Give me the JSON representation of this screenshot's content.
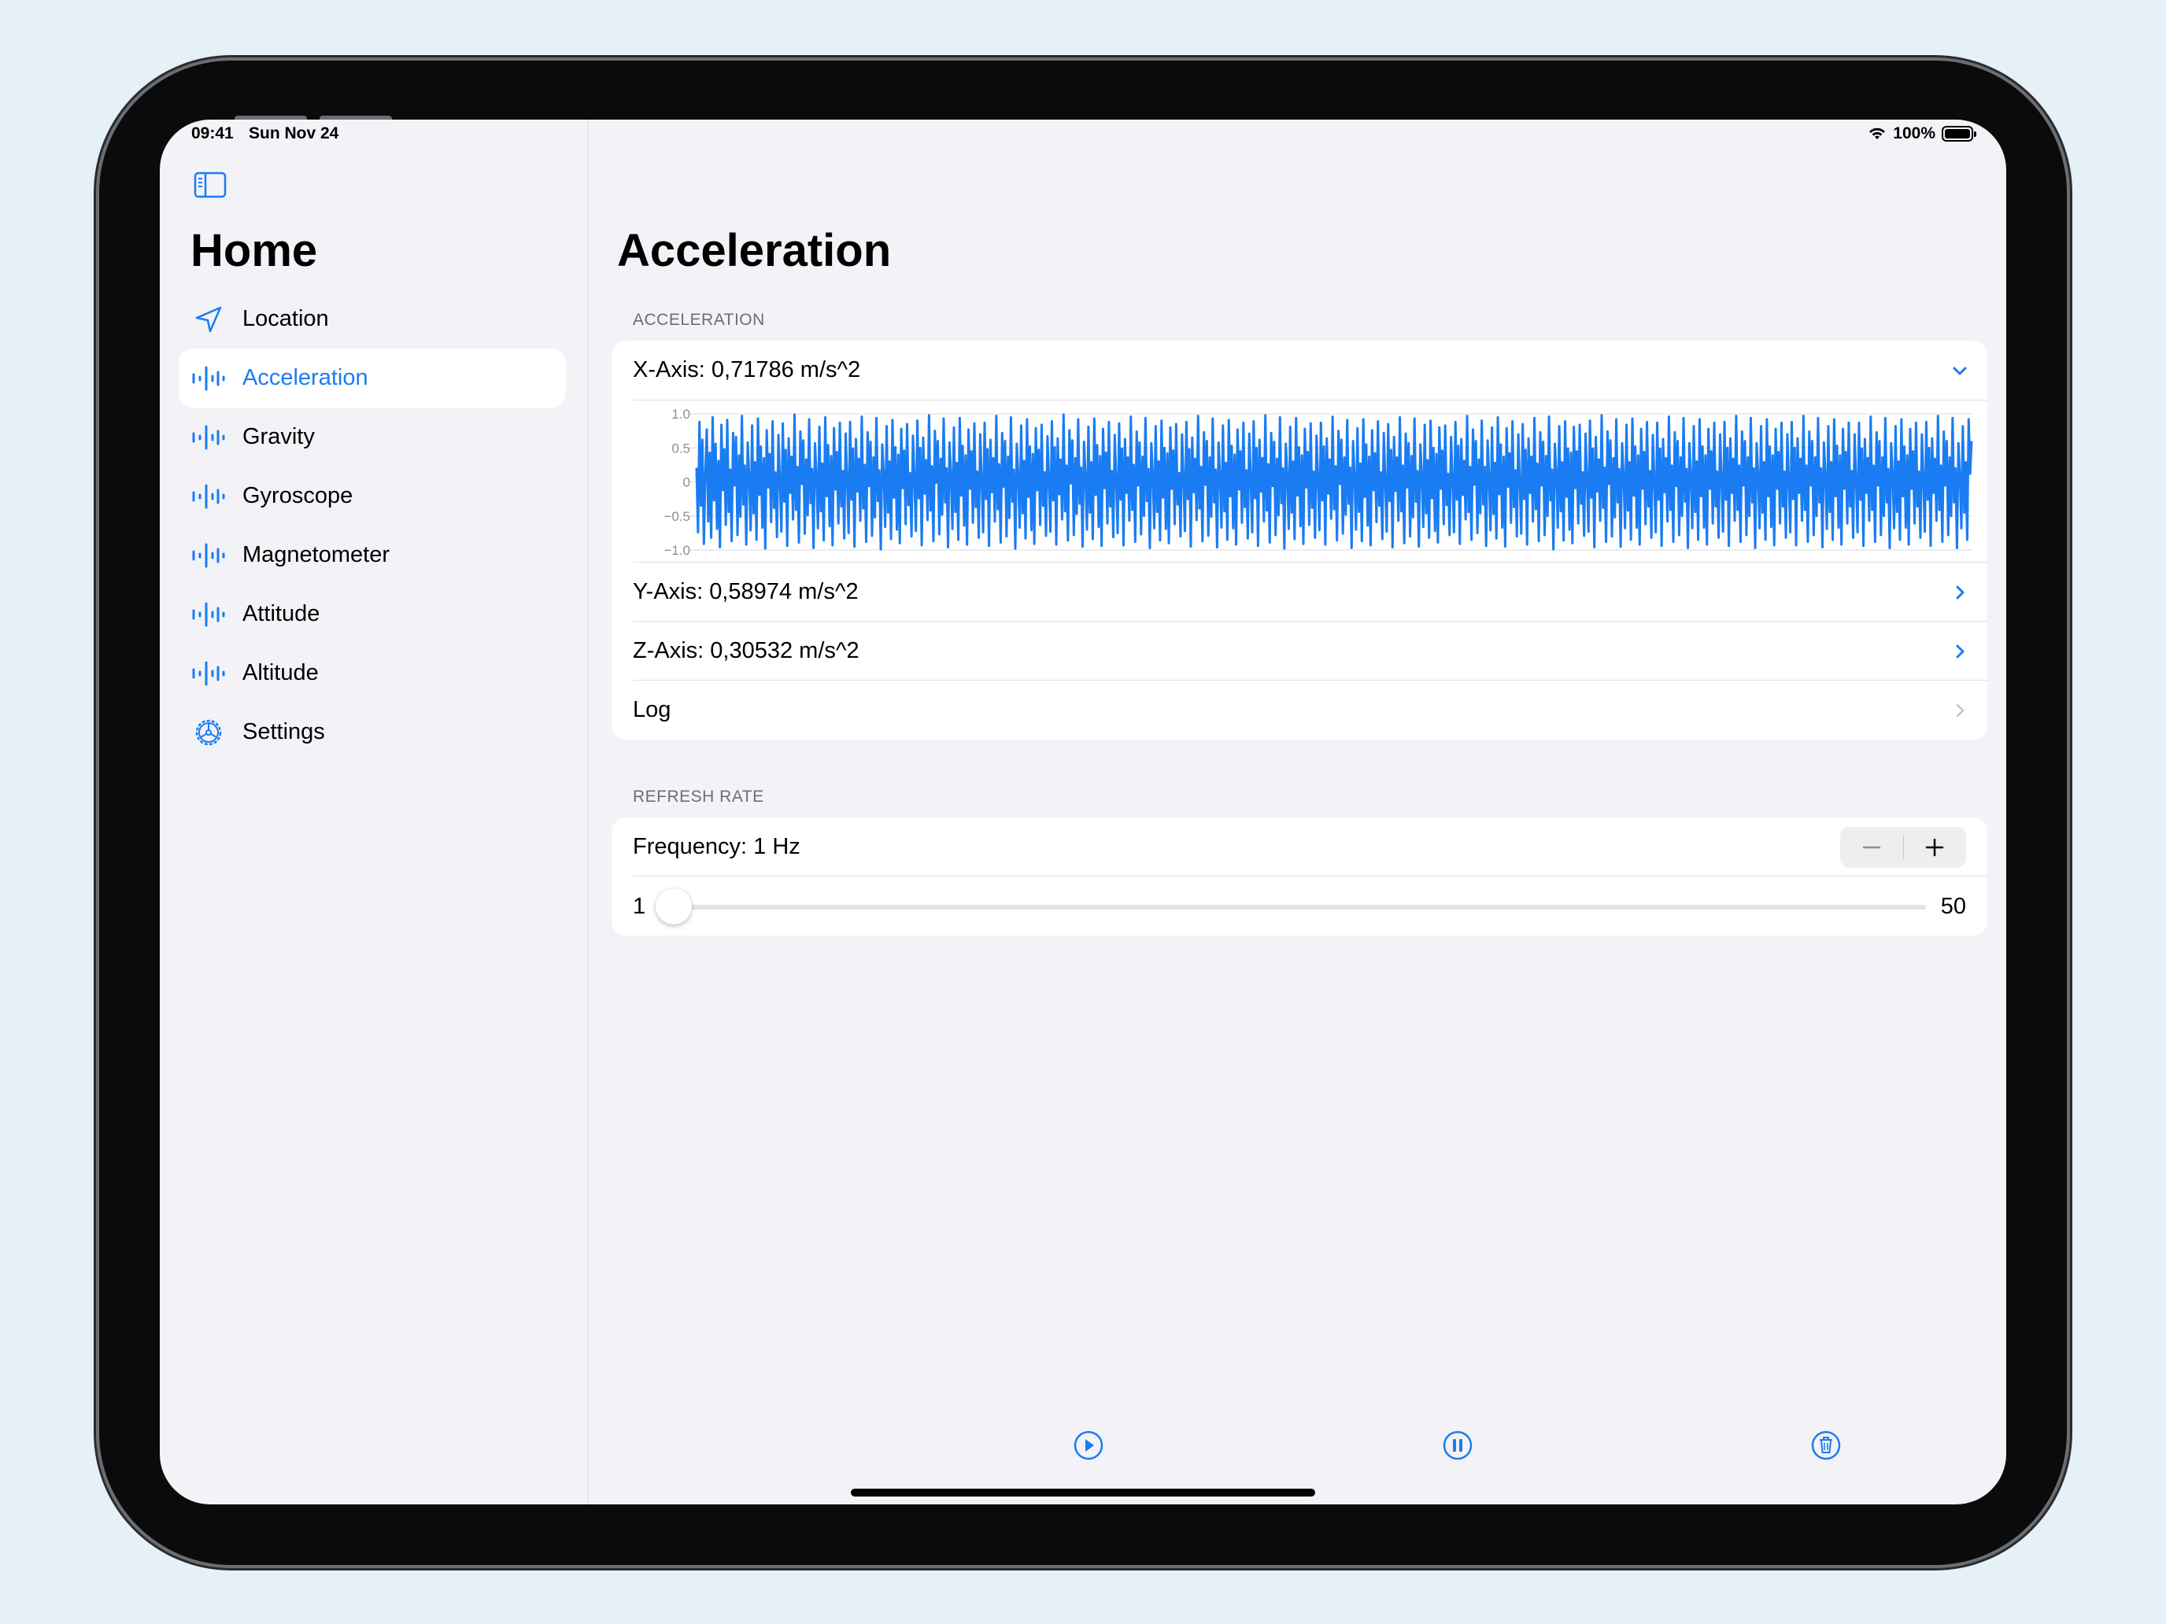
{
  "status_bar": {
    "time": "09:41",
    "date": "Sun Nov 24",
    "battery": "100%"
  },
  "sidebar": {
    "title": "Home",
    "items": [
      {
        "label": "Location",
        "icon": "location-arrow-icon",
        "selected": false
      },
      {
        "label": "Acceleration",
        "icon": "waveform-icon",
        "selected": true
      },
      {
        "label": "Gravity",
        "icon": "waveform-icon",
        "selected": false
      },
      {
        "label": "Gyroscope",
        "icon": "waveform-icon",
        "selected": false
      },
      {
        "label": "Magnetometer",
        "icon": "waveform-icon",
        "selected": false
      },
      {
        "label": "Attitude",
        "icon": "waveform-icon",
        "selected": false
      },
      {
        "label": "Altitude",
        "icon": "waveform-icon",
        "selected": false
      },
      {
        "label": "Settings",
        "icon": "gear-icon",
        "selected": false
      }
    ]
  },
  "main": {
    "title": "Acceleration",
    "acceleration_section": {
      "header": "ACCELERATION",
      "x_axis": "X-Axis: 0,71786 m/s^2",
      "y_axis": "Y-Axis: 0,58974 m/s^2",
      "z_axis": "Z-Axis: 0,30532 m/s^2",
      "log": "Log"
    },
    "refresh_section": {
      "header": "REFRESH RATE",
      "frequency": "Frequency: 1 Hz",
      "slider_min": "1",
      "slider_max": "50",
      "slider_value": 1
    }
  },
  "colors": {
    "accent": "#1a7cf2",
    "background": "#f2f2f7"
  },
  "chart_data": {
    "type": "line",
    "y_ticks": [
      "1.0",
      "0.5",
      "0",
      "−0.5",
      "−1.0"
    ],
    "ylim": [
      -1.0,
      1.0
    ],
    "series": [
      {
        "values": [
          0.21,
          -0.74,
          0.88,
          -0.35,
          0.62,
          -0.91,
          0.12,
          0.77,
          -0.58,
          0.43,
          -0.82,
          0.95,
          -0.27,
          0.56,
          -0.69,
          0.31,
          -0.96,
          0.84,
          -0.12,
          0.48,
          -0.63,
          0.91,
          -0.44,
          0.18,
          -0.87,
          0.72,
          -0.05,
          0.66,
          -0.78,
          0.39,
          -0.51,
          0.97,
          -0.33,
          0.24,
          -0.92,
          0.58,
          0.07,
          -0.71,
          0.83,
          -0.46,
          0.29,
          -0.85,
          0.93,
          -0.19,
          0.52,
          -0.67,
          0.35,
          -0.98,
          0.76,
          -0.08,
          0.41,
          -0.59,
          0.89,
          -0.38,
          0.14,
          -0.81,
          0.69,
          0.02,
          -0.73,
          0.86,
          -0.29,
          0.47,
          -0.94,
          0.64,
          -0.16,
          0.37,
          -0.55,
          0.99,
          -0.41,
          0.22,
          -0.89,
          0.74,
          -0.03,
          0.61,
          -0.76,
          0.33,
          -0.49,
          0.92,
          -0.31,
          0.19,
          -0.97,
          0.57,
          0.09,
          -0.68,
          0.81,
          -0.43,
          0.27,
          -0.86,
          0.95,
          -0.21,
          0.54,
          -0.65,
          0.38,
          -0.93,
          0.79,
          -0.11,
          0.44,
          -0.61,
          0.87,
          -0.36,
          0.16,
          -0.83,
          0.71,
          0.04,
          -0.75,
          0.88,
          -0.26,
          0.49,
          -0.95,
          0.63,
          -0.14,
          0.34,
          -0.57,
          0.96,
          -0.39,
          0.25,
          -0.88,
          0.73,
          -0.06,
          0.59,
          -0.79,
          0.36,
          -0.52,
          0.94,
          -0.28,
          0.17,
          -0.99,
          0.55,
          0.11,
          -0.66,
          0.82,
          -0.45,
          0.3,
          -0.84,
          0.91,
          -0.23,
          0.51,
          -0.7,
          0.4,
          -0.9,
          0.78,
          -0.09,
          0.46,
          -0.62,
          0.85,
          -0.34,
          0.13,
          -0.8,
          0.68,
          0.06,
          -0.72,
          0.9,
          -0.24,
          0.5,
          -0.93,
          0.65,
          -0.17,
          0.32,
          -0.56,
          0.98,
          -0.42,
          0.23,
          -0.87,
          0.75,
          -0.01,
          0.6,
          -0.77,
          0.34,
          -0.48,
          0.93,
          -0.3,
          0.2,
          -0.96,
          0.58,
          0.08,
          -0.69,
          0.8,
          -0.44,
          0.28,
          -0.85,
          0.94,
          -0.2,
          0.53,
          -0.64,
          0.39,
          -0.92,
          0.77,
          -0.1,
          0.45,
          -0.6,
          0.86,
          -0.37,
          0.15,
          -0.82,
          0.7,
          0.03,
          -0.74,
          0.87,
          -0.25,
          0.48,
          -0.94,
          0.62,
          -0.15,
          0.35,
          -0.58,
          0.97,
          -0.4,
          0.26,
          -0.89,
          0.72,
          -0.07,
          0.6,
          -0.8,
          0.37,
          -0.53,
          0.95,
          -0.29,
          0.18,
          -0.98,
          0.56,
          0.1,
          -0.67,
          0.83,
          -0.46,
          0.31,
          -0.83,
          0.92,
          -0.22,
          0.52,
          -0.71,
          0.41,
          -0.91,
          0.79,
          -0.12,
          0.47,
          -0.63,
          0.84,
          -0.35,
          0.14,
          -0.79,
          0.67,
          0.05,
          -0.73,
          0.89,
          -0.27,
          0.51,
          -0.92,
          0.64,
          -0.18,
          0.33,
          -0.55,
          0.99,
          -0.43,
          0.24,
          -0.86,
          0.76,
          -0.02,
          0.61,
          -0.78,
          0.35,
          -0.47,
          0.92,
          -0.32,
          0.21,
          -0.95,
          0.59,
          0.07,
          -0.7,
          0.81,
          -0.45,
          0.29,
          -0.84,
          0.93,
          -0.19,
          0.54,
          -0.66,
          0.38,
          -0.94,
          0.78,
          -0.09,
          0.43,
          -0.61,
          0.88,
          -0.36,
          0.16,
          -0.81,
          0.69,
          0.02,
          -0.75,
          0.86,
          -0.26,
          0.49,
          -0.93,
          0.63,
          -0.16,
          0.36,
          -0.57,
          0.96,
          -0.41,
          0.25,
          -0.88,
          0.74,
          -0.05,
          0.58,
          -0.77,
          0.37,
          -0.5,
          0.94,
          -0.28,
          0.19,
          -0.97,
          0.57,
          0.12,
          -0.68,
          0.82,
          -0.44,
          0.3,
          -0.86,
          0.9,
          -0.23,
          0.5,
          -0.69,
          0.42,
          -0.9,
          0.8,
          -0.1,
          0.46,
          -0.62,
          0.85,
          -0.33,
          0.13,
          -0.8,
          0.7,
          0.04,
          -0.72,
          0.88,
          -0.25,
          0.48,
          -0.95,
          0.65,
          -0.15,
          0.34,
          -0.56,
          0.97,
          -0.39,
          0.22,
          -0.87,
          0.73,
          -0.04,
          0.6,
          -0.79,
          0.36,
          -0.51,
          0.93,
          -0.3,
          0.18,
          -0.96,
          0.58,
          0.09,
          -0.67,
          0.83,
          -0.43,
          0.28,
          -0.85,
          0.91,
          -0.21,
          0.53,
          -0.68,
          0.4,
          -0.92,
          0.77,
          -0.11,
          0.45,
          -0.6,
          0.87,
          -0.37,
          0.17,
          -0.83,
          0.71,
          0.03,
          -0.74,
          0.89,
          -0.24,
          0.5,
          -0.94,
          0.62,
          -0.14,
          0.35,
          -0.58,
          0.98,
          -0.42,
          0.26,
          -0.89,
          0.72,
          -0.06,
          0.59,
          -0.78,
          0.34,
          -0.49,
          0.95,
          -0.31,
          0.2,
          -0.98,
          0.56,
          0.1,
          -0.69,
          0.81,
          -0.45,
          0.3,
          -0.84,
          0.94,
          -0.2,
          0.51,
          -0.65,
          0.39,
          -0.91,
          0.78,
          -0.08,
          0.44,
          -0.63,
          0.86,
          -0.38,
          0.15,
          -0.82,
          0.68,
          0.05,
          -0.71,
          0.87,
          -0.27,
          0.52,
          -0.92,
          0.64,
          -0.17,
          0.33,
          -0.54,
          0.96,
          -0.4,
          0.23,
          -0.86,
          0.75,
          -0.03,
          0.62,
          -0.76,
          0.36,
          -0.48,
          0.91,
          -0.32,
          0.21,
          -0.97,
          0.6,
          0.08,
          -0.7,
          0.79,
          -0.44,
          0.27,
          -0.87,
          0.92,
          -0.22,
          0.55,
          -0.64,
          0.37,
          -0.93,
          0.76,
          -0.12,
          0.42,
          -0.59,
          0.89,
          -0.35,
          0.14,
          -0.84,
          0.72,
          0.01,
          -0.73,
          0.85,
          -0.28,
          0.47,
          -0.96,
          0.66,
          -0.13,
          0.36,
          -0.57,
          0.95,
          -0.43,
          0.24,
          -0.9,
          0.71,
          -0.08,
          0.57,
          -0.8,
          0.38,
          -0.52,
          0.93,
          -0.29,
          0.16,
          -0.95,
          0.55,
          0.11,
          -0.66,
          0.84,
          -0.46,
          0.32,
          -0.82,
          0.9,
          -0.24,
          0.5,
          -0.72,
          0.41,
          -0.89,
          0.8,
          -0.1,
          0.46,
          -0.62,
          0.83,
          -0.34,
          0.12,
          -0.78,
          0.66,
          0.06,
          -0.74,
          0.88,
          -0.26,
          0.53,
          -0.91,
          0.63,
          -0.19,
          0.31,
          -0.55,
          0.97,
          -0.44,
          0.22,
          -0.85,
          0.77,
          -0.04,
          0.6,
          -0.75,
          0.33,
          -0.46,
          0.9,
          -0.33,
          0.22,
          -0.94,
          0.61,
          0.06,
          -0.71,
          0.8,
          -0.47,
          0.28,
          -0.83,
          0.95,
          -0.18,
          0.55,
          -0.67,
          0.37,
          -0.95,
          0.79,
          -0.07,
          0.42,
          -0.6,
          0.89,
          -0.37,
          0.17,
          -0.8,
          0.7,
          0.01,
          -0.76,
          0.85,
          -0.25,
          0.47,
          -0.92,
          0.64,
          -0.16,
          0.37,
          -0.58,
          0.94,
          -0.4,
          0.27,
          -0.87,
          0.73,
          -0.05,
          0.59,
          -0.78,
          0.38,
          -0.5,
          0.96,
          -0.27,
          0.18,
          -0.99,
          0.56,
          0.13,
          -0.67,
          0.82,
          -0.43,
          0.29,
          -0.86,
          0.89,
          -0.22,
          0.49,
          -0.7,
          0.43,
          -0.9,
          0.81,
          -0.09,
          0.45,
          -0.61,
          0.84,
          -0.32,
          0.14,
          -0.79,
          0.71,
          0.04,
          -0.73,
          0.9,
          -0.23,
          0.49,
          -0.96,
          0.66,
          -0.14,
          0.33,
          -0.57,
          0.98,
          -0.38,
          0.21,
          -0.88,
          0.74,
          -0.03,
          0.61,
          -0.8,
          0.35,
          -0.52,
          0.92,
          -0.3,
          0.19,
          -0.95,
          0.57,
          0.08,
          -0.68,
          0.84,
          -0.42,
          0.29,
          -0.85,
          0.93,
          -0.2,
          0.52,
          -0.67,
          0.39,
          -0.92,
          0.78,
          -0.1,
          0.44,
          -0.62,
          0.88,
          -0.36,
          0.16,
          -0.82,
          0.69,
          0.03,
          -0.74,
          0.87,
          -0.26,
          0.49,
          -0.94,
          0.63,
          -0.15,
          0.35,
          -0.58,
          0.96,
          -0.41,
          0.24,
          -0.88,
          0.73,
          -0.06,
          0.6,
          -0.78,
          0.36,
          -0.5,
          0.94,
          -0.29,
          0.19,
          -0.97,
          0.57,
          0.1,
          -0.68,
          0.82,
          -0.44,
          0.3,
          -0.85,
          0.92,
          -0.21,
          0.52,
          -0.67,
          0.39,
          -0.92,
          0.78,
          -0.1,
          0.45,
          -0.61,
          0.87,
          -0.36,
          0.15,
          -0.82,
          0.7,
          0.03,
          -0.73,
          0.88,
          -0.26,
          0.5,
          -0.94,
          0.64,
          -0.16,
          0.34,
          -0.57,
          0.97,
          -0.41,
          0.24,
          -0.88,
          0.74,
          -0.05,
          0.6,
          -0.78,
          0.36,
          -0.5,
          0.94,
          -0.3,
          0.2,
          -0.97,
          0.57,
          0.09,
          -0.68,
          0.82,
          -0.45,
          0.29,
          -0.85,
          0.92,
          -0.21,
          0.52,
          -0.66,
          0.39,
          -0.93,
          0.78,
          -0.1,
          0.44,
          -0.61,
          0.87,
          -0.36,
          0.15,
          -0.82,
          0.7,
          0.03,
          -0.74,
          0.88,
          -0.25,
          0.5,
          -0.93,
          0.64,
          -0.16,
          0.34,
          -0.57,
          0.97,
          -0.41,
          0.24,
          -0.88,
          0.74,
          -0.05,
          0.6,
          -0.78,
          0.36,
          -0.5,
          0.94,
          -0.3,
          0.2,
          -0.96,
          0.58,
          0.09,
          -0.69,
          0.82,
          -0.44,
          0.29,
          -0.85,
          0.92,
          -0.21,
          0.53,
          -0.67,
          0.39,
          -0.92,
          0.78,
          -0.1,
          0.44,
          -0.61,
          0.87,
          -0.36,
          0.16,
          -0.82,
          0.7,
          0.03,
          -0.74,
          0.87,
          -0.26,
          0.49,
          -0.94,
          0.63,
          -0.16,
          0.35,
          -0.57,
          0.96,
          -0.41,
          0.24,
          -0.88,
          0.73,
          -0.05,
          0.6,
          -0.78,
          0.36,
          -0.5,
          0.94,
          -0.3,
          0.19,
          -0.97,
          0.57,
          0.1,
          -0.68,
          0.82,
          -0.44,
          0.3,
          -0.85,
          0.92,
          -0.21,
          0.52,
          -0.67,
          0.39,
          -0.92,
          0.78,
          -0.1,
          0.45,
          -0.61,
          0.87,
          -0.36,
          0.15,
          -0.82,
          0.7,
          0.03,
          -0.73,
          0.88,
          -0.26,
          0.5,
          -0.94,
          0.64,
          -0.16,
          0.34,
          -0.57,
          0.97,
          -0.41,
          0.24,
          -0.88,
          0.74,
          -0.05,
          0.6,
          -0.78,
          0.36,
          -0.5,
          0.94,
          -0.3,
          0.2,
          -0.97,
          0.57,
          0.09,
          -0.68,
          0.82,
          -0.45,
          0.29,
          -0.85,
          0.92,
          0.12,
          0.6
        ]
      }
    ]
  }
}
